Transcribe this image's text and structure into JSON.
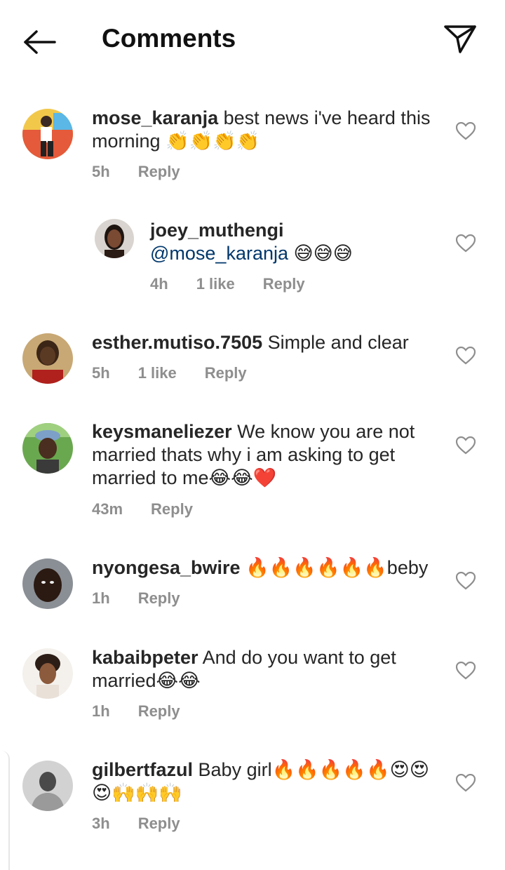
{
  "header": {
    "title": "Comments",
    "back_icon": "arrow-left-icon",
    "send_icon": "paper-plane-icon"
  },
  "comments": [
    {
      "username": "mose_karanja",
      "text": "best news i've heard this morning 👏👏👏👏",
      "time": "5h",
      "likes": "",
      "reply": "Reply"
    },
    {
      "username": "joey_muthengi",
      "mention": "@mose_karanja",
      "text": " 😅😅😅",
      "time": "4h",
      "likes": "1 like",
      "reply": "Reply"
    },
    {
      "username": "esther.mutiso.7505",
      "text": "Simple and clear",
      "time": "5h",
      "likes": "1 like",
      "reply": "Reply"
    },
    {
      "username": "keysmaneliezer",
      "text": "We know you are not married thats why i am asking to get married to me😂😂❤️",
      "time": "43m",
      "likes": "",
      "reply": "Reply"
    },
    {
      "username": "nyongesa_bwire",
      "text": "🔥🔥🔥🔥🔥🔥beby",
      "time": "1h",
      "likes": "",
      "reply": "Reply"
    },
    {
      "username": "kabaibpeter",
      "text": "And do you want to get married😂😂",
      "time": "1h",
      "likes": "",
      "reply": "Reply"
    },
    {
      "username": "gilbertfazul",
      "text": "Baby girl🔥🔥🔥🔥🔥😍😍😍🙌🙌🙌",
      "time": "3h",
      "likes": "",
      "reply": "Reply"
    }
  ],
  "colors": {
    "text": "#262626",
    "meta": "#8e8e8e",
    "mention": "#00376b"
  }
}
